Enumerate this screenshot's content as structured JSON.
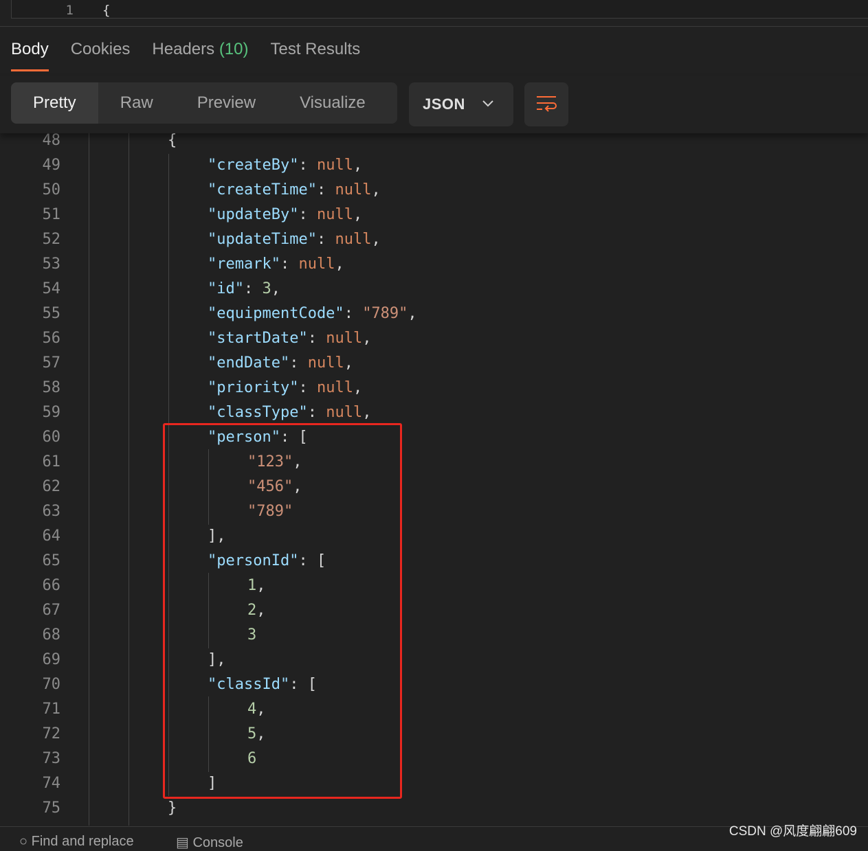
{
  "request_editor": {
    "line_number": "1",
    "code": "{"
  },
  "response_tabs": [
    {
      "label": "Body",
      "active": true
    },
    {
      "label": "Cookies",
      "active": false
    },
    {
      "label": "Headers",
      "count": "(10)",
      "active": false
    },
    {
      "label": "Test Results",
      "active": false
    }
  ],
  "view_modes": [
    {
      "label": "Pretty",
      "active": true
    },
    {
      "label": "Raw",
      "active": false
    },
    {
      "label": "Preview",
      "active": false
    },
    {
      "label": "Visualize",
      "active": false
    }
  ],
  "format_select": {
    "value": "JSON",
    "icon": "chevron-down-icon"
  },
  "wrap_button": {
    "icon": "wrap-lines-icon"
  },
  "code_lines": [
    {
      "n": "48",
      "indent": 2,
      "tokens": [
        [
          "q",
          "{"
        ]
      ]
    },
    {
      "n": "49",
      "indent": 3,
      "tokens": [
        [
          "k",
          "\"createBy\""
        ],
        [
          "q",
          ": "
        ],
        [
          "nl",
          "null"
        ],
        [
          "q",
          ","
        ]
      ]
    },
    {
      "n": "50",
      "indent": 3,
      "tokens": [
        [
          "k",
          "\"createTime\""
        ],
        [
          "q",
          ": "
        ],
        [
          "nl",
          "null"
        ],
        [
          "q",
          ","
        ]
      ]
    },
    {
      "n": "51",
      "indent": 3,
      "tokens": [
        [
          "k",
          "\"updateBy\""
        ],
        [
          "q",
          ": "
        ],
        [
          "nl",
          "null"
        ],
        [
          "q",
          ","
        ]
      ]
    },
    {
      "n": "52",
      "indent": 3,
      "tokens": [
        [
          "k",
          "\"updateTime\""
        ],
        [
          "q",
          ": "
        ],
        [
          "nl",
          "null"
        ],
        [
          "q",
          ","
        ]
      ]
    },
    {
      "n": "53",
      "indent": 3,
      "tokens": [
        [
          "k",
          "\"remark\""
        ],
        [
          "q",
          ": "
        ],
        [
          "nl",
          "null"
        ],
        [
          "q",
          ","
        ]
      ]
    },
    {
      "n": "54",
      "indent": 3,
      "tokens": [
        [
          "k",
          "\"id\""
        ],
        [
          "q",
          ": "
        ],
        [
          "num",
          "3"
        ],
        [
          "q",
          ","
        ]
      ]
    },
    {
      "n": "55",
      "indent": 3,
      "tokens": [
        [
          "k",
          "\"equipmentCode\""
        ],
        [
          "q",
          ": "
        ],
        [
          "str",
          "\"789\""
        ],
        [
          "q",
          ","
        ]
      ]
    },
    {
      "n": "56",
      "indent": 3,
      "tokens": [
        [
          "k",
          "\"startDate\""
        ],
        [
          "q",
          ": "
        ],
        [
          "nl",
          "null"
        ],
        [
          "q",
          ","
        ]
      ]
    },
    {
      "n": "57",
      "indent": 3,
      "tokens": [
        [
          "k",
          "\"endDate\""
        ],
        [
          "q",
          ": "
        ],
        [
          "nl",
          "null"
        ],
        [
          "q",
          ","
        ]
      ]
    },
    {
      "n": "58",
      "indent": 3,
      "tokens": [
        [
          "k",
          "\"priority\""
        ],
        [
          "q",
          ": "
        ],
        [
          "nl",
          "null"
        ],
        [
          "q",
          ","
        ]
      ]
    },
    {
      "n": "59",
      "indent": 3,
      "tokens": [
        [
          "k",
          "\"classType\""
        ],
        [
          "q",
          ": "
        ],
        [
          "nl",
          "null"
        ],
        [
          "q",
          ","
        ]
      ]
    },
    {
      "n": "60",
      "indent": 3,
      "tokens": [
        [
          "k",
          "\"person\""
        ],
        [
          "q",
          ": ["
        ]
      ]
    },
    {
      "n": "61",
      "indent": 4,
      "tokens": [
        [
          "str",
          "\"123\""
        ],
        [
          "q",
          ","
        ]
      ]
    },
    {
      "n": "62",
      "indent": 4,
      "tokens": [
        [
          "str",
          "\"456\""
        ],
        [
          "q",
          ","
        ]
      ]
    },
    {
      "n": "63",
      "indent": 4,
      "tokens": [
        [
          "str",
          "\"789\""
        ]
      ]
    },
    {
      "n": "64",
      "indent": 3,
      "tokens": [
        [
          "q",
          "],"
        ]
      ]
    },
    {
      "n": "65",
      "indent": 3,
      "tokens": [
        [
          "k",
          "\"personId\""
        ],
        [
          "q",
          ": ["
        ]
      ]
    },
    {
      "n": "66",
      "indent": 4,
      "tokens": [
        [
          "num",
          "1"
        ],
        [
          "q",
          ","
        ]
      ]
    },
    {
      "n": "67",
      "indent": 4,
      "tokens": [
        [
          "num",
          "2"
        ],
        [
          "q",
          ","
        ]
      ]
    },
    {
      "n": "68",
      "indent": 4,
      "tokens": [
        [
          "num",
          "3"
        ]
      ]
    },
    {
      "n": "69",
      "indent": 3,
      "tokens": [
        [
          "q",
          "],"
        ]
      ]
    },
    {
      "n": "70",
      "indent": 3,
      "tokens": [
        [
          "k",
          "\"classId\""
        ],
        [
          "q",
          ": ["
        ]
      ]
    },
    {
      "n": "71",
      "indent": 4,
      "tokens": [
        [
          "num",
          "4"
        ],
        [
          "q",
          ","
        ]
      ]
    },
    {
      "n": "72",
      "indent": 4,
      "tokens": [
        [
          "num",
          "5"
        ],
        [
          "q",
          ","
        ]
      ]
    },
    {
      "n": "73",
      "indent": 4,
      "tokens": [
        [
          "num",
          "6"
        ]
      ]
    },
    {
      "n": "74",
      "indent": 3,
      "tokens": [
        [
          "q",
          "]"
        ]
      ]
    },
    {
      "n": "75",
      "indent": 2,
      "tokens": [
        [
          "q",
          "}"
        ]
      ]
    }
  ],
  "statusbar": {
    "find_replace": "Find and replace",
    "console": "Console"
  },
  "watermark": "CSDN @风度翩翩609",
  "colors": {
    "accent": "#ff6c37",
    "highlight_box": "#e8271f",
    "key": "#9cdcfe",
    "string": "#ce9178",
    "number": "#b5cea8",
    "null": "#d7875f"
  }
}
